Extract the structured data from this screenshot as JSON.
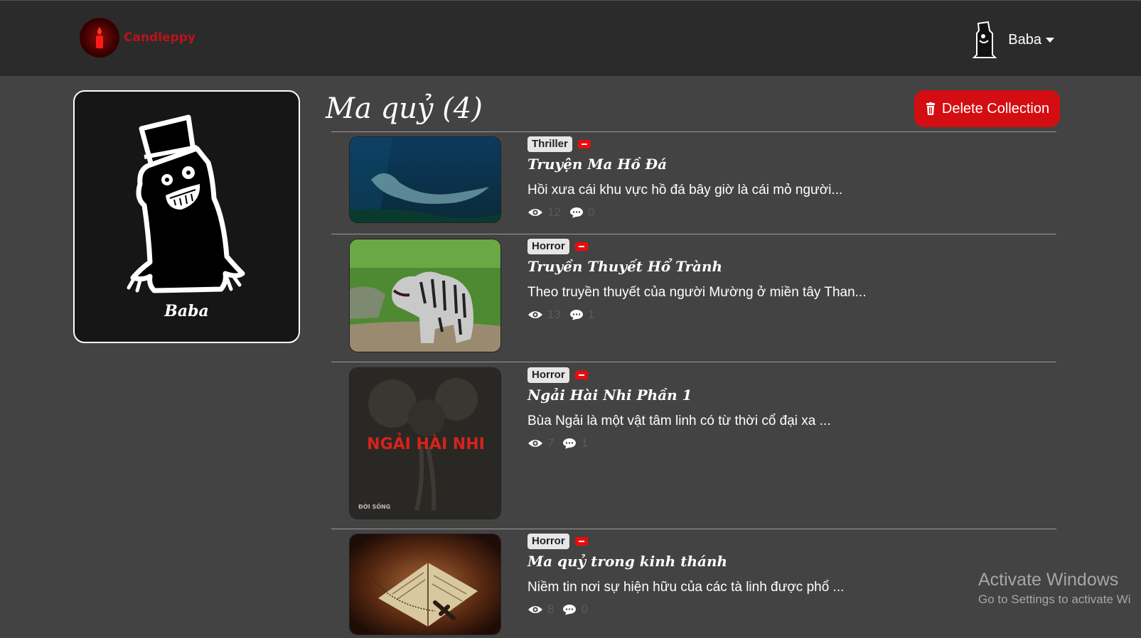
{
  "brand": {
    "name": "Candleppy"
  },
  "user": {
    "name": "Baba"
  },
  "profile": {
    "name": "Baba"
  },
  "collection": {
    "title": "Ma quỷ (4)",
    "delete_label": "Delete Collection"
  },
  "stories": [
    {
      "genre": "Thriller",
      "title": "Truyện Ma Hồ Đá",
      "excerpt": "Hồi xưa cái khu vực hồ đá bây giờ là cái mỏ người...",
      "views": "12",
      "comments": "0"
    },
    {
      "genre": "Horror",
      "title": "Truyền Thuyết Hổ Trành",
      "excerpt": "Theo truyền thuyết của người Mường ở miền tây Than...",
      "views": "13",
      "comments": "1"
    },
    {
      "genre": "Horror",
      "title": "Ngải Hài Nhi Phần 1",
      "excerpt": "Bùa Ngải là một vật tâm linh có từ thời cổ đại xa ...",
      "views": "7",
      "comments": "1",
      "thumb_text": "NGẢI HÀI NHI",
      "thumb_caption": "ĐỜI SỐNG"
    },
    {
      "genre": "Horror",
      "title": "Ma quỷ trong kinh thánh",
      "excerpt": "Niềm tin nơi sự hiện hữu của các tà linh được phổ ...",
      "views": "8",
      "comments": "0"
    }
  ],
  "watermark": {
    "line1": "Activate Windows",
    "line2": "Go to Settings to activate Wi"
  },
  "colors": {
    "accent": "#d40d12",
    "background": "#434343",
    "navbar": "#2b2b2b",
    "brand": "#b8141a"
  }
}
